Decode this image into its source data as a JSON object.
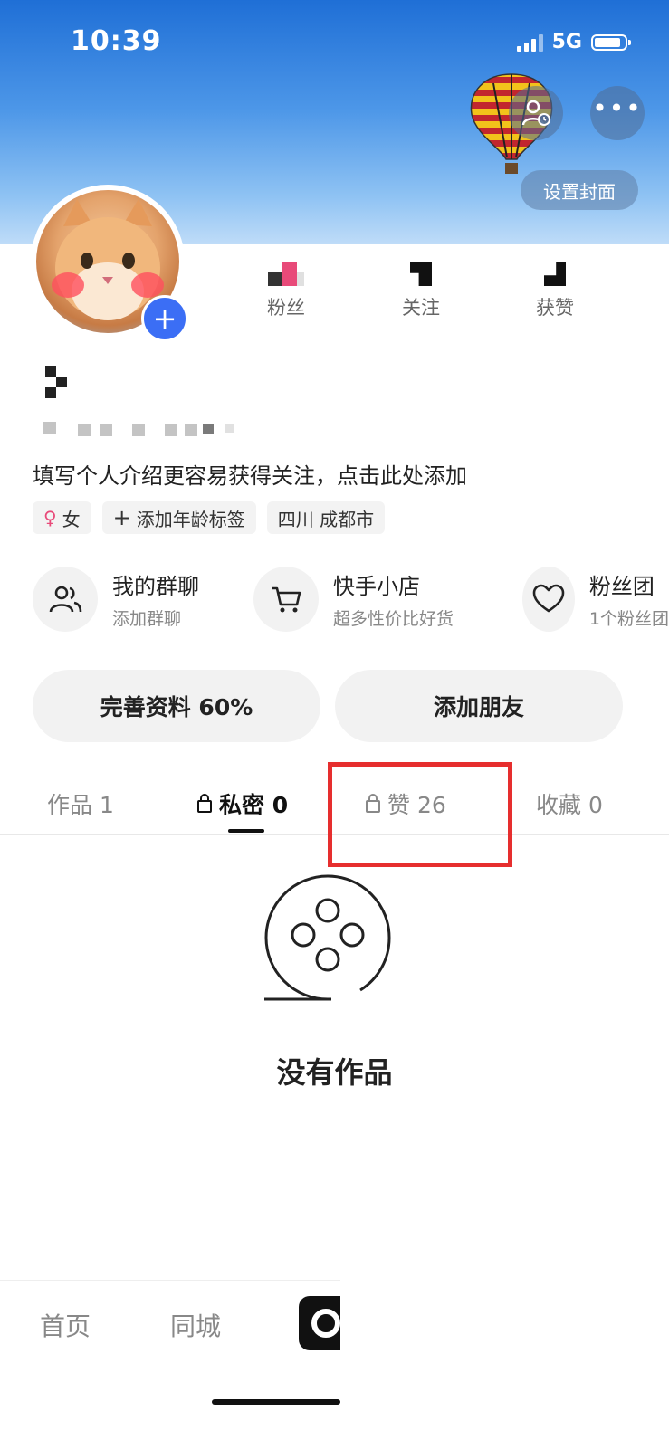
{
  "status_bar": {
    "time": "10:39",
    "network": "5G"
  },
  "header": {
    "set_cover_label": "设置封面"
  },
  "stats": [
    {
      "label": "粉丝"
    },
    {
      "label": "关注"
    },
    {
      "label": "获赞"
    }
  ],
  "profile": {
    "bio": "填写个人介绍更容易获得关注，点击此处添加",
    "tags": [
      {
        "icon": "female-icon",
        "label": "女"
      },
      {
        "icon": "plus-icon",
        "label": "添加年龄标签"
      },
      {
        "label": "四川 成都市"
      }
    ]
  },
  "shortcuts": [
    {
      "icon": "group-chat-icon",
      "title": "我的群聊",
      "subtitle": "添加群聊"
    },
    {
      "icon": "cart-icon",
      "title": "快手小店",
      "subtitle": "超多性价比好货"
    },
    {
      "icon": "heart-icon",
      "title": "粉丝团",
      "subtitle": "1个粉丝团"
    }
  ],
  "actions": {
    "complete_profile": "完善资料 60%",
    "add_friend": "添加朋友"
  },
  "tabs": [
    {
      "label": "作品 1",
      "locked": false,
      "active": false
    },
    {
      "label": "私密 0",
      "locked": true,
      "active": true
    },
    {
      "label": "赞 26",
      "locked": true,
      "active": false,
      "highlighted": true
    },
    {
      "label": "收藏 0",
      "locked": false,
      "active": false
    }
  ],
  "empty_state": {
    "text": "没有作品"
  },
  "bottom_nav": [
    {
      "label": "首页"
    },
    {
      "label": "同城"
    }
  ],
  "colors": {
    "accent_blue": "#3b6ef5",
    "highlight_red": "#e62e2e",
    "female_pink": "#e84a79"
  }
}
